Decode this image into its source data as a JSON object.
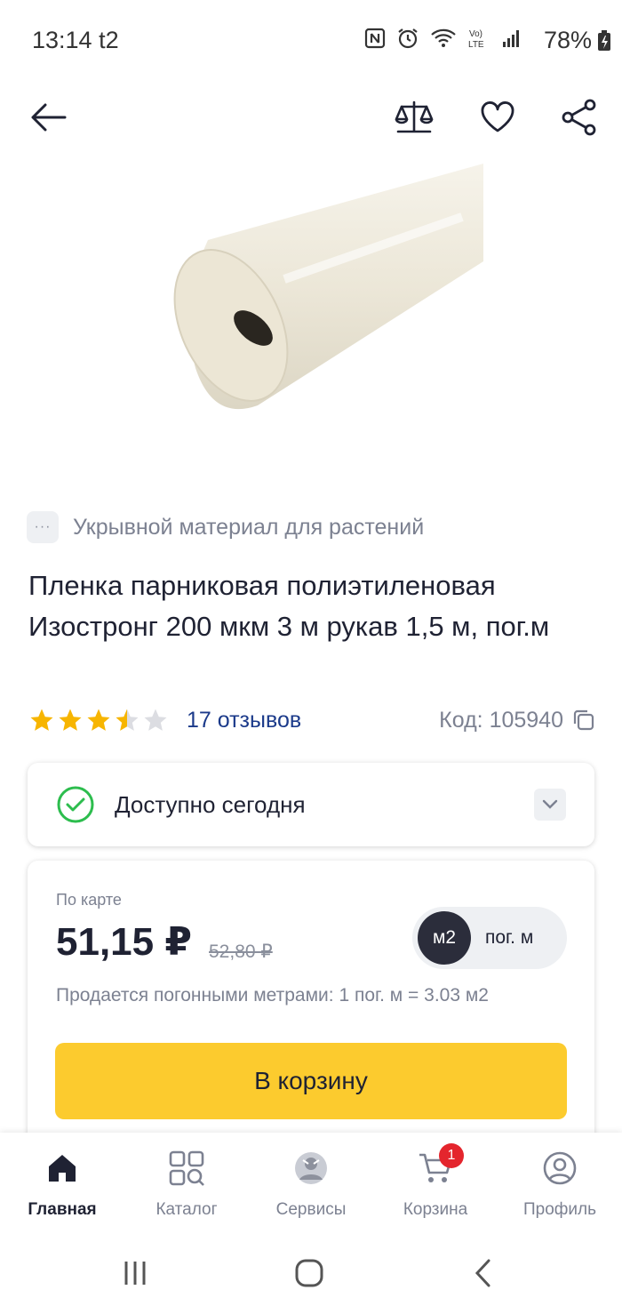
{
  "status_bar": {
    "time": "13:14",
    "carrier": "t2",
    "battery": "78%"
  },
  "category": {
    "dots": "···",
    "label": "Укрывной материал для растений"
  },
  "product": {
    "title": "Пленка парниковая полиэтиленовая Изостронг 200 мкм 3 м рукав 1,5 м, пог.м",
    "rating": 3.5,
    "reviews_label": "17 отзывов",
    "code_label": "Код: 105940"
  },
  "availability": {
    "text": "Доступно сегодня"
  },
  "price": {
    "caption": "По карте",
    "current": "51,15 ₽",
    "old": "52,80 ₽",
    "unit_active": "м2",
    "unit_inactive": "пог. м",
    "sold_note": "Продается погонными метрами: 1 пог. м = 3.03 м2",
    "cart_button": "В корзину"
  },
  "bottom_nav": {
    "items": [
      {
        "label": "Главная",
        "icon": "home-icon",
        "active": true
      },
      {
        "label": "Каталог",
        "icon": "catalog-icon",
        "active": false
      },
      {
        "label": "Сервисы",
        "icon": "services-icon",
        "active": false
      },
      {
        "label": "Корзина",
        "icon": "cart-icon",
        "active": false,
        "badge": "1"
      },
      {
        "label": "Профиль",
        "icon": "profile-icon",
        "active": false
      }
    ]
  },
  "colors": {
    "accent_yellow": "#fccb2e",
    "link_blue": "#1b3a8a",
    "badge_red": "#e4252d",
    "success_green": "#2dbd4e",
    "star_yellow": "#f7b500"
  }
}
